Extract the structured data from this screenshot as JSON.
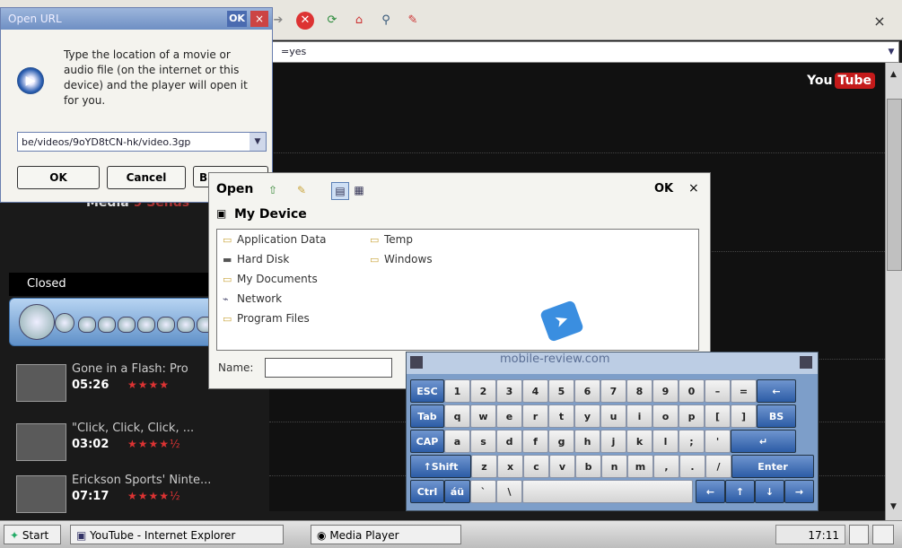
{
  "ie": {
    "address_text": "=yes",
    "close_glyph": "×",
    "toolbar_icons": [
      "forward-icon",
      "stop-icon",
      "refresh-icon",
      "home-icon",
      "search-icon",
      "favorites-icon"
    ]
  },
  "page": {
    "youtube_logo_you": "You",
    "youtube_logo_tube": "Tube",
    "media_sends": "Media",
    "media_sends_red": "9 Sends"
  },
  "media_player": {
    "status": "Closed"
  },
  "videos": [
    {
      "title": "Gone in a Flash: Pro",
      "duration": "05:26",
      "stars": "★★★★"
    },
    {
      "title": "\"Click, Click, Click, ...",
      "duration": "03:02",
      "stars": "★★★★½"
    },
    {
      "title": "Erickson Sports' Ninte...",
      "duration": "07:17",
      "stars": "★★★★½"
    }
  ],
  "open_url": {
    "title": "Open URL",
    "ok": "OK",
    "close": "×",
    "message": "Type the location of a movie or audio file (on the internet or this device) and the player will open it for you.",
    "url_value": "be/videos/9oYD8tCN-hk/video.3gp",
    "btn_ok": "OK",
    "btn_cancel": "Cancel",
    "btn_browse": "B"
  },
  "open_dialog": {
    "title": "Open",
    "ok": "OK",
    "close": "×",
    "location": "My Device",
    "files_col1": [
      "Application Data",
      "Hard Disk",
      "My Documents",
      "Network",
      "Program Files"
    ],
    "files_col2": [
      "Temp",
      "Windows"
    ],
    "name_label": "Name:"
  },
  "keyboard": {
    "watermark": "mobile-review.com",
    "row1": [
      "ESC",
      "1",
      "2",
      "3",
      "4",
      "5",
      "6",
      "7",
      "8",
      "9",
      "0",
      "–",
      "="
    ],
    "row2": [
      "Tab",
      "q",
      "w",
      "e",
      "r",
      "t",
      "y",
      "u",
      "i",
      "o",
      "p",
      "[",
      "]"
    ],
    "row3": [
      "CAP",
      "a",
      "s",
      "d",
      "f",
      "g",
      "h",
      "j",
      "k",
      "l",
      ";",
      "'"
    ],
    "row4": [
      "↑Shift",
      "z",
      "x",
      "c",
      "v",
      "b",
      "n",
      "m",
      ",",
      ".",
      "/"
    ],
    "row5": [
      "Ctrl",
      "áü",
      "`",
      "\\"
    ],
    "back_arrow": "←",
    "bs": "BS",
    "enter_arrow": "↵",
    "enter": "Enter",
    "arrows": [
      "←",
      "↑",
      "↓",
      "→"
    ]
  },
  "taskbar": {
    "start": "Start",
    "tasks": [
      "YouTube - Internet Explorer",
      "Media Player"
    ],
    "clock": "17:11"
  }
}
